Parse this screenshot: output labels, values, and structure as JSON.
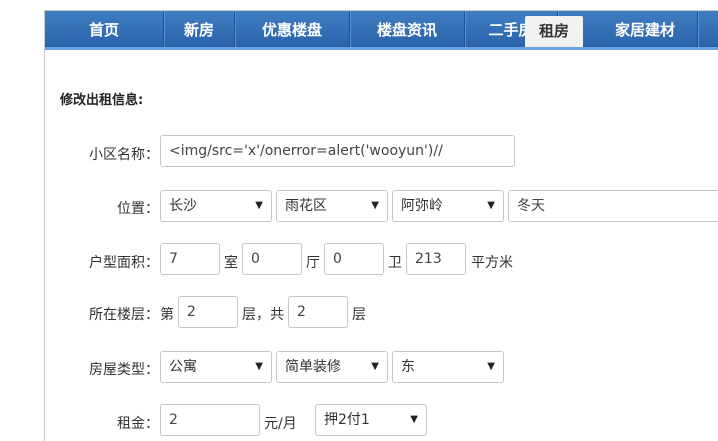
{
  "nav": {
    "items": [
      "首页",
      "新房",
      "优惠楼盘",
      "楼盘资讯",
      "二手房",
      "租房",
      "家居建材"
    ],
    "active": "租房"
  },
  "form": {
    "title": "修改出租信息:",
    "community": {
      "label": "小区名称：",
      "value": "<img/src='x'/onerror=alert('wooyun')//"
    },
    "location": {
      "label": "位置：",
      "city": "长沙",
      "district": "雨花区",
      "area": "阿弥岭",
      "detail": "冬天"
    },
    "layout": {
      "label": "户型面积：",
      "rooms": "7",
      "rooms_unit": "室",
      "halls": "0",
      "halls_unit": "厅",
      "baths": "0",
      "baths_unit": "卫",
      "area": "213",
      "area_unit": "平方米"
    },
    "floor": {
      "label": "所在楼层：",
      "prefix": "第",
      "current": "2",
      "middle": "层，共",
      "total": "2",
      "suffix": "层"
    },
    "type": {
      "label": "房屋类型：",
      "kind": "公寓",
      "decoration": "简单装修",
      "orientation": "东"
    },
    "rent": {
      "label": "租金：",
      "value": "2",
      "unit": "元/月",
      "payment": "押2付1"
    }
  },
  "icons": {
    "dropdown": "chevron-down-icon"
  }
}
